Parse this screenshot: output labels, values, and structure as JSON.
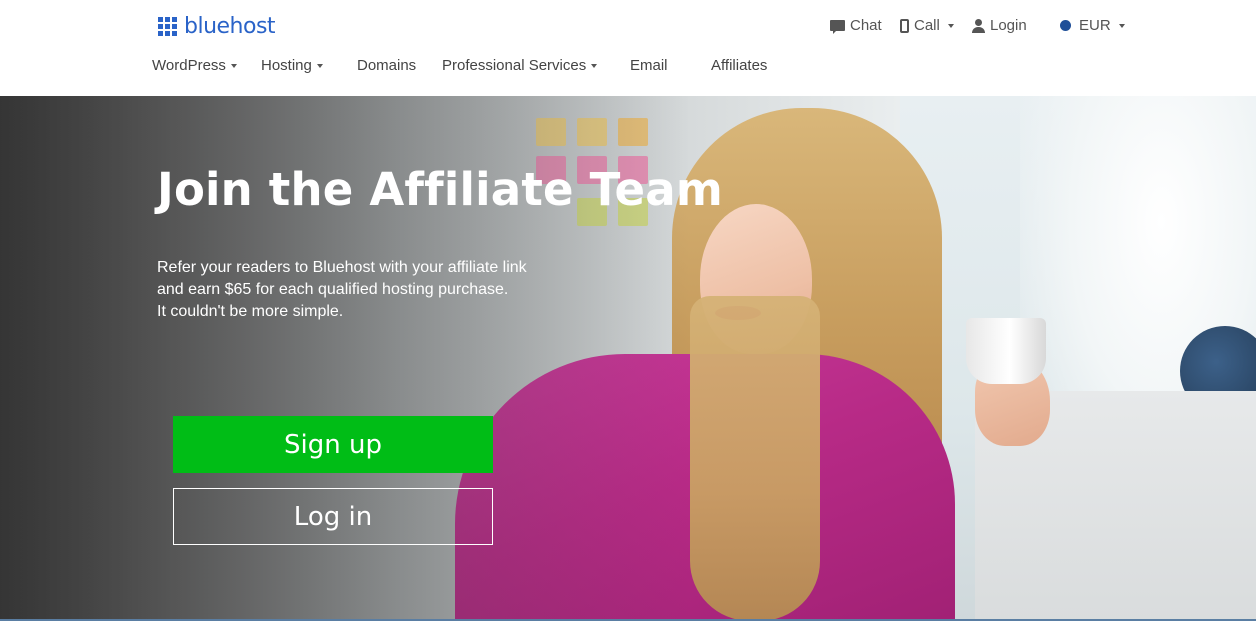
{
  "brand": {
    "name": "bluehost",
    "color": "#2a63c8"
  },
  "utility_nav": {
    "chat": {
      "label": "Chat",
      "icon": "chat-bubble-icon"
    },
    "call": {
      "label": "Call",
      "icon": "phone-icon"
    },
    "login": {
      "label": "Login",
      "icon": "user-icon"
    },
    "currency": {
      "label": "EUR",
      "icon": "globe-icon"
    }
  },
  "main_nav": {
    "items": [
      {
        "label": "WordPress",
        "dropdown": true
      },
      {
        "label": "Hosting",
        "dropdown": true
      },
      {
        "label": "Domains",
        "dropdown": false
      },
      {
        "label": "Professional Services",
        "dropdown": true
      },
      {
        "label": "Email",
        "dropdown": false
      },
      {
        "label": "Affiliates",
        "dropdown": false
      }
    ]
  },
  "hero": {
    "title": "Join the Affiliate Team",
    "copy": [
      "Refer your readers to Bluehost with your affiliate link",
      "and earn $65 for each qualified hosting purchase.",
      "It couldn't be more simple."
    ],
    "primary_button": "Sign up",
    "secondary_button": "Log in"
  },
  "colors": {
    "signup_green": "#00bd16",
    "nav_text": "#444444"
  }
}
